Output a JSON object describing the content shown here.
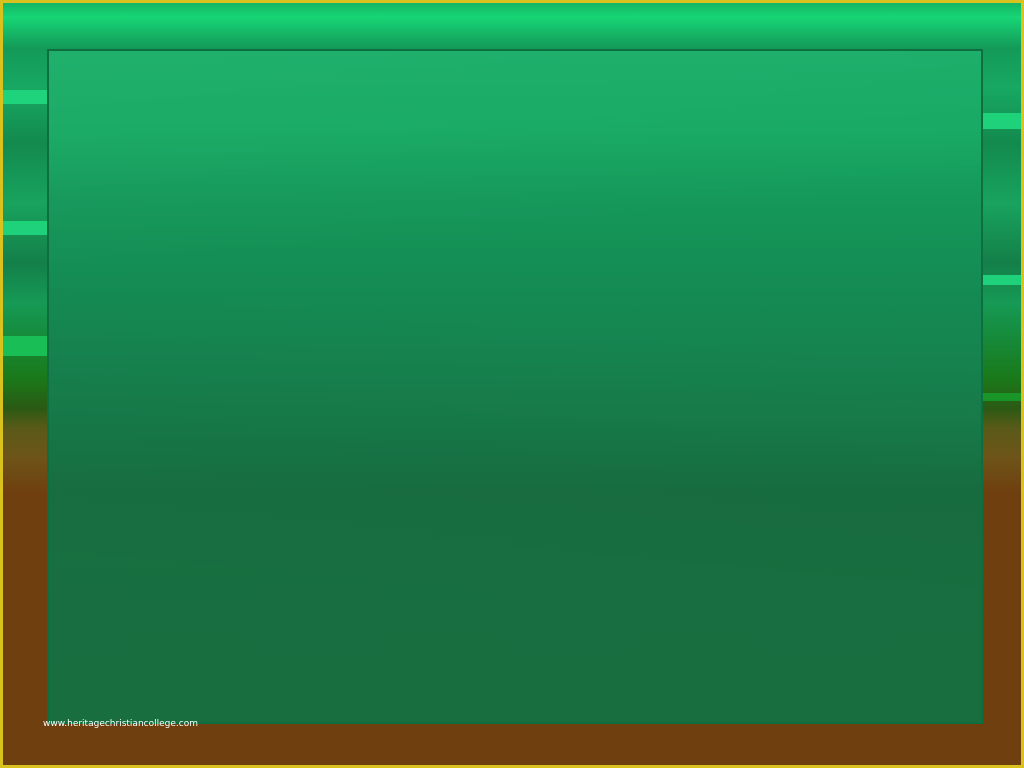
{
  "watermark": {
    "text": "www.heritagechristiancollege.com"
  },
  "colors": {
    "frame_border": "#d9c21e",
    "panel_green": "#177a48",
    "bottom_brown": "#6f3f0f",
    "accent_green": "#1fd87e"
  }
}
